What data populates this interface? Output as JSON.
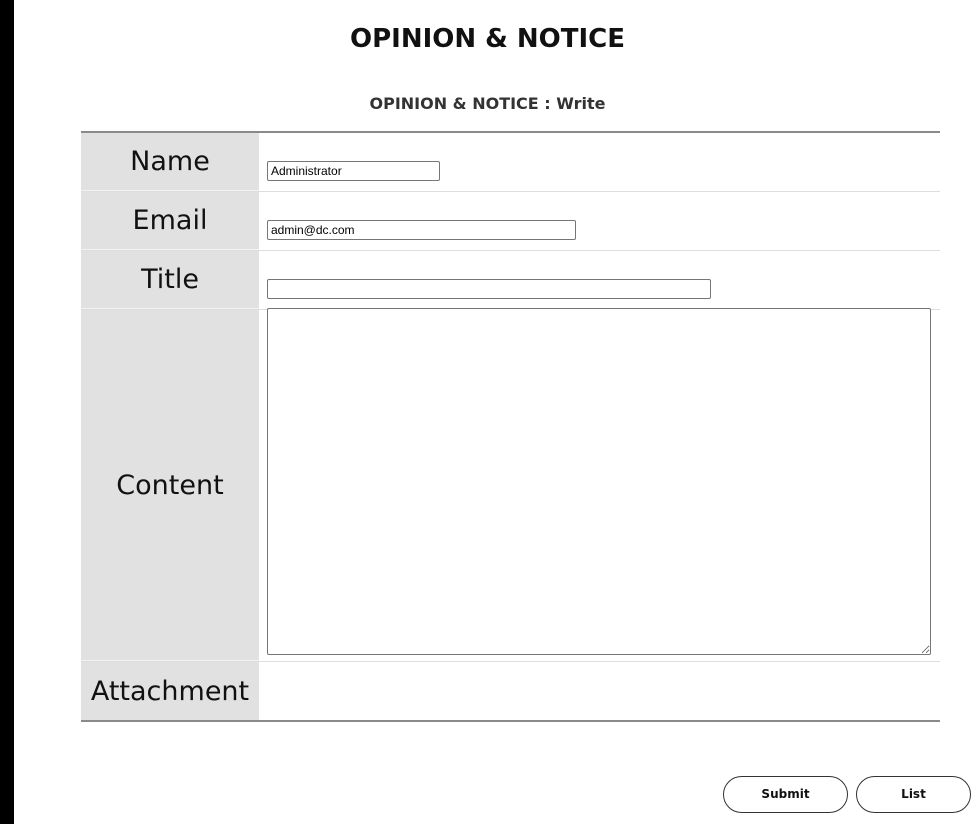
{
  "page": {
    "title": "OPINION & NOTICE",
    "subtitle": "OPINION & NOTICE : Write"
  },
  "form": {
    "name_label": "Name",
    "name_value": "Administrator",
    "email_label": "Email",
    "email_value": "admin@dc.com",
    "title_label": "Title",
    "title_value": "",
    "content_label": "Content",
    "content_value": "",
    "attachment_label": "Attachment"
  },
  "actions": {
    "submit_label": "Submit",
    "list_label": "List"
  }
}
